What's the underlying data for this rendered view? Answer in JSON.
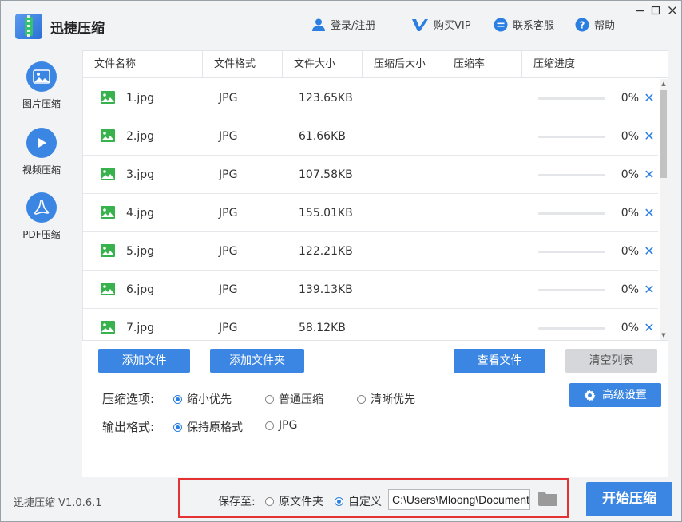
{
  "app": {
    "title": "迅捷压缩",
    "version": "迅捷压缩 V1.0.6.1"
  },
  "topnav": {
    "login": "登录/注册",
    "vip": "购买VIP",
    "service": "联系客服",
    "help": "帮助"
  },
  "sidebar": {
    "items": [
      {
        "label": "图片压缩",
        "icon": "image-icon"
      },
      {
        "label": "视频压缩",
        "icon": "play-icon"
      },
      {
        "label": "PDF压缩",
        "icon": "pdf-icon"
      }
    ]
  },
  "table": {
    "headers": [
      "文件名称",
      "文件格式",
      "文件大小",
      "压缩后大小",
      "压缩率",
      "压缩进度"
    ],
    "rows": [
      {
        "name": "1.jpg",
        "format": "JPG",
        "size": "123.65KB",
        "progress": 0,
        "progress_text": "0%"
      },
      {
        "name": "2.jpg",
        "format": "JPG",
        "size": "61.66KB",
        "progress": 0,
        "progress_text": "0%"
      },
      {
        "name": "3.jpg",
        "format": "JPG",
        "size": "107.58KB",
        "progress": 0,
        "progress_text": "0%"
      },
      {
        "name": "4.jpg",
        "format": "JPG",
        "size": "155.01KB",
        "progress": 0,
        "progress_text": "0%"
      },
      {
        "name": "5.jpg",
        "format": "JPG",
        "size": "122.21KB",
        "progress": 0,
        "progress_text": "0%"
      },
      {
        "name": "6.jpg",
        "format": "JPG",
        "size": "139.13KB",
        "progress": 0,
        "progress_text": "0%"
      },
      {
        "name": "7.jpg",
        "format": "JPG",
        "size": "58.12KB",
        "progress": 0,
        "progress_text": "0%"
      }
    ]
  },
  "actions": {
    "add_file": "添加文件",
    "add_folder": "添加文件夹",
    "view_files": "查看文件",
    "clear_list": "清空列表",
    "advanced": "高级设置"
  },
  "options": {
    "compress_label": "压缩选项:",
    "compress_choices": [
      "缩小优先",
      "普通压缩",
      "清晰优先"
    ],
    "compress_selected": "缩小优先",
    "format_label": "输出格式:",
    "format_choices": [
      "保持原格式",
      "JPG"
    ],
    "format_selected": "保持原格式"
  },
  "save": {
    "label": "保存至:",
    "choices": [
      "原文件夹",
      "自定义"
    ],
    "selected": "自定义",
    "path": "C:\\Users\\Mloong\\Documents"
  },
  "start_button": "开始压缩",
  "colors": {
    "accent": "#3b86e3",
    "icon_green": "#37b24d",
    "highlight_red": "#e53333"
  }
}
